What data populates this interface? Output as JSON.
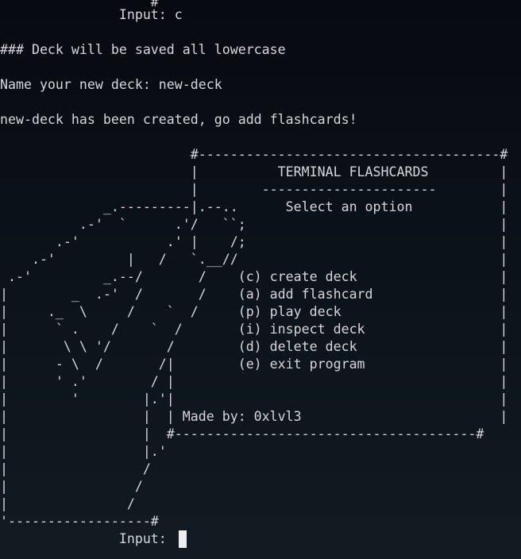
{
  "terminal": {
    "lines": [
      "                    #",
      "                Input: c",
      "",
      " ### Deck will be saved all lowercase",
      "",
      " Name your new deck: new-deck",
      "",
      " new-deck has been created, go add flashcards!",
      "",
      "                         #--------------------------------------#",
      "                         |          TERMINAL FLASHCARDS         |",
      "                         |        ----------------------        |",
      "              _.---------|.--..      Select an option           |",
      "           .-'  `      .'/   ``;                                |",
      "        .-'           .' |    /;                                |",
      "     .-'         |   /   `.__//                                 |",
      "  .-'         _.--/       /    (c) create deck                  |",
      " |        _  .-'  /       /    (a) add flashcard                |",
      " |     ._  \\     /    `  /     (p) play deck                    |",
      " |      ` .    /    `  /       (i) inspect deck                 |",
      " |       \\ \\ '/       /        (d) delete deck                  |",
      " |      - \\  /       /|        (e) exit program                 |",
      " |      ' .'        / |                                         |",
      " |        '        |.'|                                         |",
      " |                 |  | Made by: 0xlvl3                         |",
      " |                 |  #--------------------------------------#",
      " |                 |.'",
      " |                 /",
      " |                /",
      " |               /",
      " '------------------#",
      "                Input: "
    ]
  }
}
